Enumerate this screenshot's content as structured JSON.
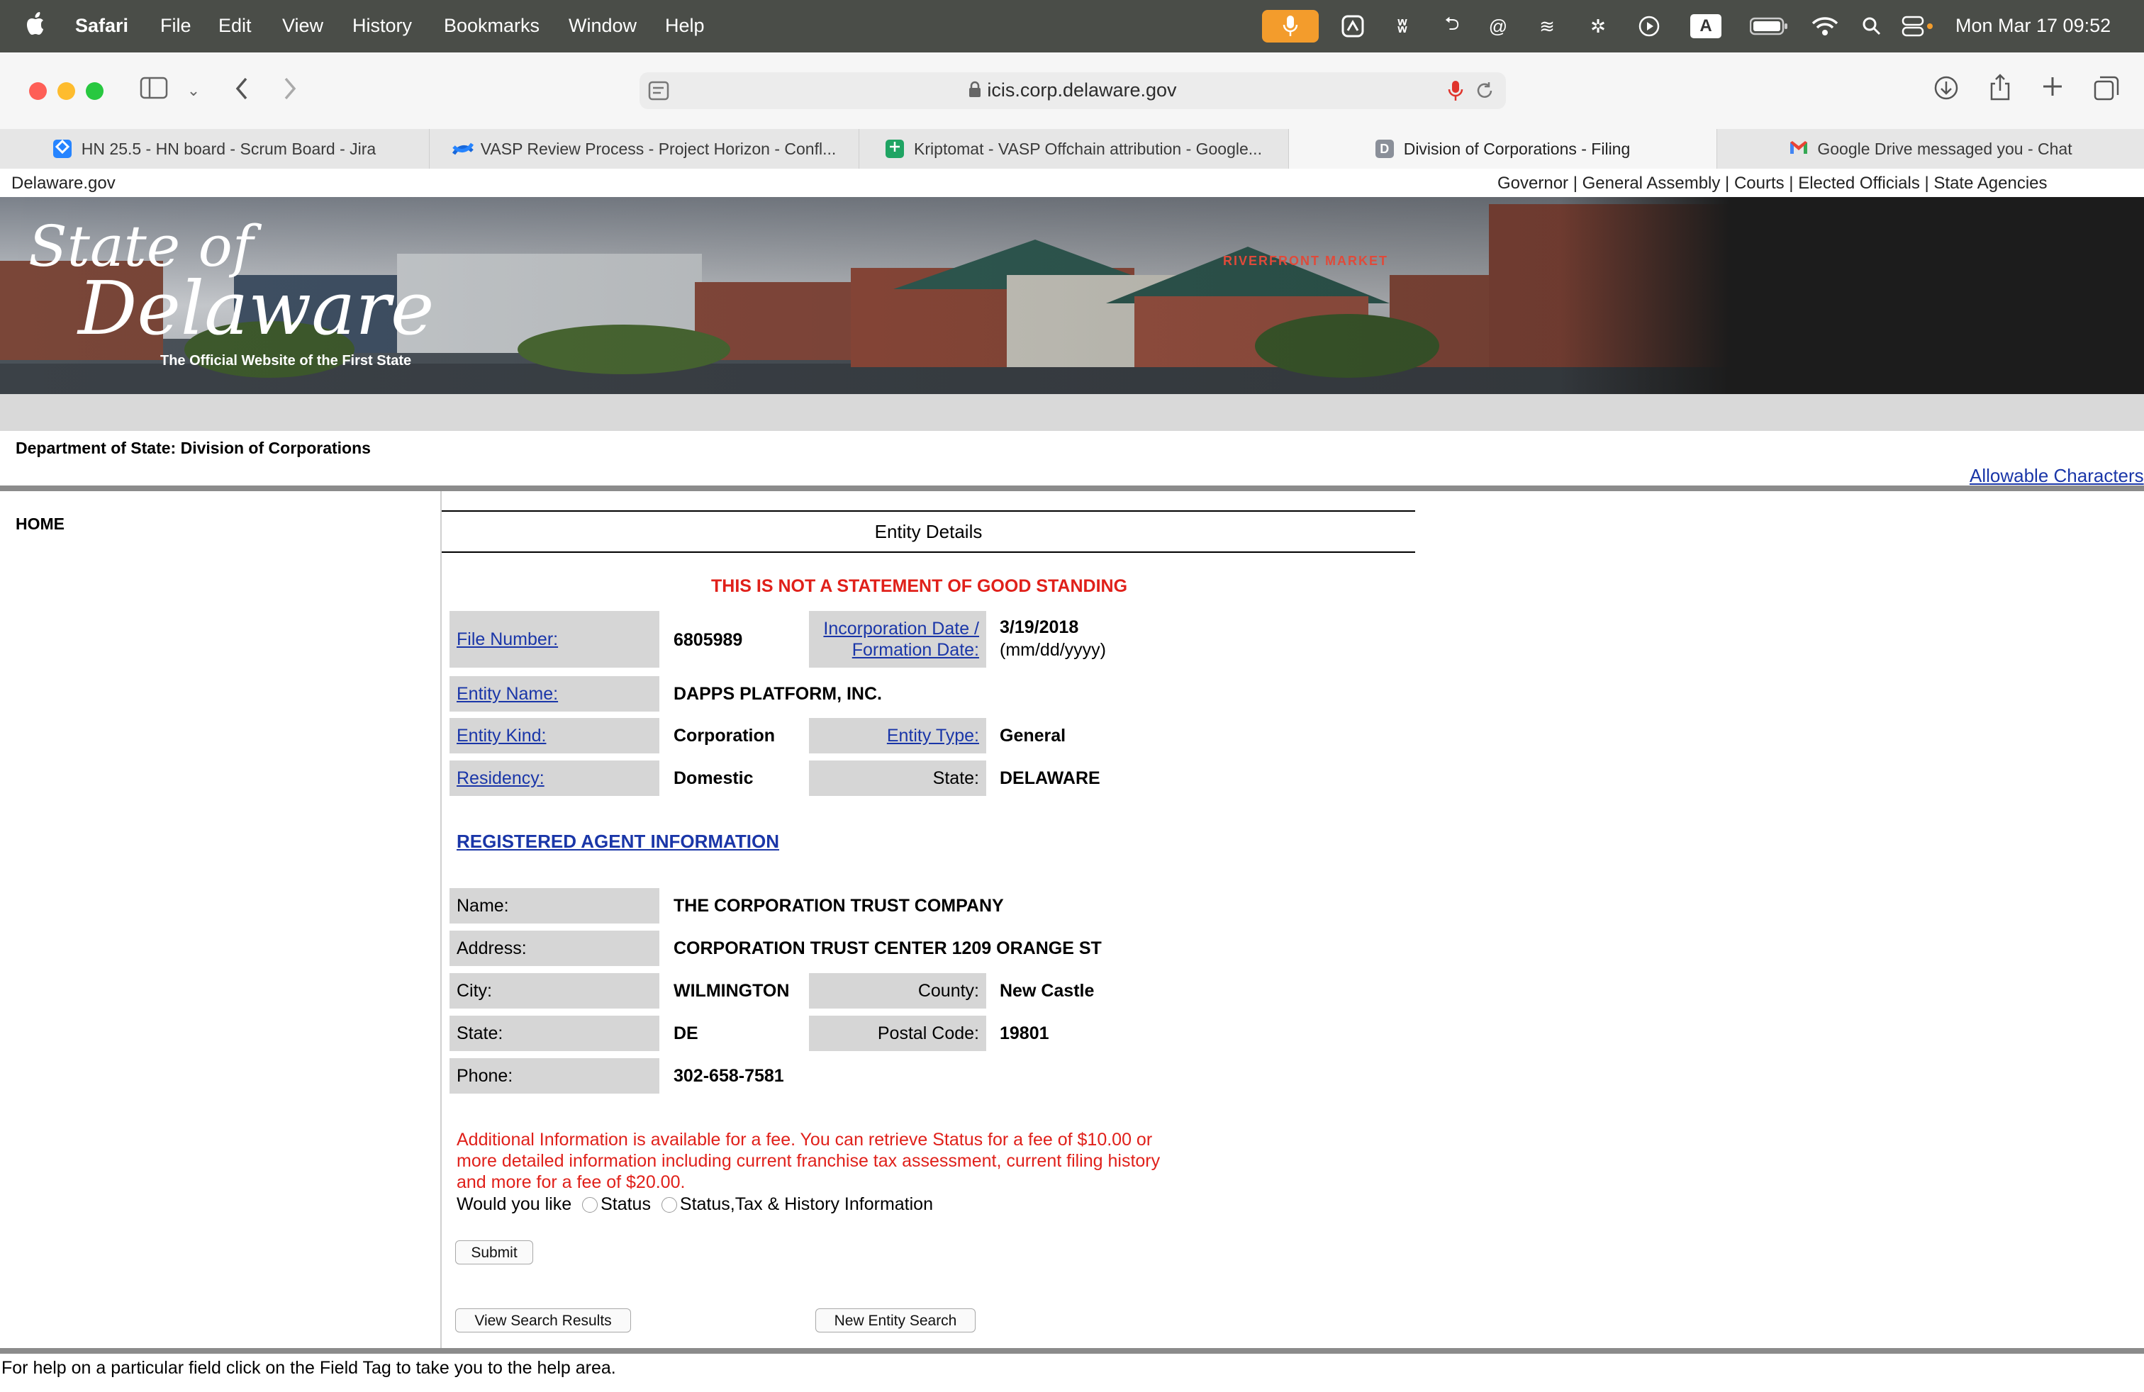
{
  "menubar": {
    "apple": "",
    "items": [
      "Safari",
      "File",
      "Edit",
      "View",
      "History",
      "Bookmarks",
      "Window",
      "Help"
    ],
    "clock": "Mon Mar 17  09:52",
    "status_icons": [
      "microphone-icon",
      "launch-icon",
      "chart-icon",
      "arrow-icon",
      "at-icon",
      "layers-icon",
      "bug-icon",
      "play-icon",
      "keyboard-a-icon",
      "battery-icon",
      "wifi-icon",
      "search-icon",
      "control-center-icon"
    ],
    "keyboard_label": "A"
  },
  "browser": {
    "url": "icis.corp.delaware.gov",
    "tabs": [
      {
        "label": "HN 25.5 - HN board - Scrum Board - Jira",
        "icon": "jira-icon",
        "active": false
      },
      {
        "label": "VASP Review Process - Project Horizon - Confl...",
        "icon": "confluence-icon",
        "active": false
      },
      {
        "label": "Kriptomat - VASP Offchain attribution - Google...",
        "icon": "sheets-icon",
        "active": false
      },
      {
        "label": "Division of Corporations - Filing",
        "icon": "letter-d-icon",
        "favicon_letter": "D",
        "active": true
      },
      {
        "label": "Google Drive messaged you - Chat",
        "icon": "gmail-icon",
        "active": false
      }
    ]
  },
  "site": {
    "home_link": "Delaware.gov",
    "top_links": "Governor | General Assembly | Courts | Elected Officials | State Agencies",
    "banner_logo_line1": "State of",
    "banner_logo_line2": "Delaware",
    "banner_tagline": "The Official Website of the First State",
    "banner_sign": "RIVERFRONT MARKET",
    "department": "Department of State: Division of Corporations",
    "allowable_link": "Allowable Characters",
    "nav_home": "HOME"
  },
  "entity": {
    "title": "Entity Details",
    "warning": "THIS IS NOT A STATEMENT OF GOOD STANDING",
    "file_number_label": "File Number:",
    "file_number": "6805989",
    "inc_date_label_1": "Incorporation Date /",
    "inc_date_label_2": "Formation Date:",
    "inc_date": "3/19/2018",
    "inc_date_format": "(mm/dd/yyyy)",
    "entity_name_label": "Entity Name:",
    "entity_name": "DAPPS PLATFORM, INC.",
    "entity_kind_label": "Entity Kind:",
    "entity_kind": "Corporation",
    "entity_type_label": "Entity Type:",
    "entity_type": "General",
    "residency_label": "Residency:",
    "residency": "Domestic",
    "state_label": "State:",
    "state": "DELAWARE"
  },
  "agent": {
    "heading": "REGISTERED AGENT INFORMATION",
    "name_label": "Name:",
    "name": "THE CORPORATION TRUST COMPANY",
    "address_label": "Address:",
    "address": "CORPORATION TRUST CENTER 1209 ORANGE ST",
    "city_label": "City:",
    "city": "WILMINGTON",
    "county_label": "County:",
    "county": "New Castle",
    "state_label": "State:",
    "state": "DE",
    "postal_label": "Postal Code:",
    "postal": "19801",
    "phone_label": "Phone:",
    "phone": "302-658-7581"
  },
  "fee": {
    "line1": "Additional Information is available for a fee. You can retrieve Status for a fee of $10.00 or",
    "line2": "more detailed information including current franchise tax assessment, current filing history",
    "line3": "and more for a fee of $20.00.",
    "question": "Would you like",
    "option_status": "Status",
    "option_full": "Status,Tax & History Information",
    "submit": "Submit",
    "view_results": "View Search Results",
    "new_search": "New Entity Search"
  },
  "footer": {
    "help": "For help on a particular field click on the Field Tag to take you to the help area."
  },
  "colors": {
    "warning_red": "#e0201a",
    "link_blue": "#1a36a8",
    "label_gray": "#d6d6d6",
    "menubar": "#4a4d48",
    "mic_orange": "#f39c2c"
  }
}
